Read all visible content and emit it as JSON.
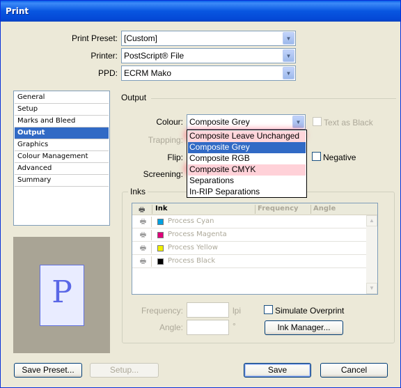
{
  "window": {
    "title": "Print"
  },
  "top": {
    "print_preset_label": "Print Preset:",
    "print_preset_value": "[Custom]",
    "printer_label": "Printer:",
    "printer_value": "PostScript® File",
    "ppd_label": "PPD:",
    "ppd_value": "ECRM Mako"
  },
  "sidebar": {
    "items": [
      {
        "label": "General"
      },
      {
        "label": "Setup"
      },
      {
        "label": "Marks and Bleed"
      },
      {
        "label": "Output"
      },
      {
        "label": "Graphics"
      },
      {
        "label": "Colour Management"
      },
      {
        "label": "Advanced"
      },
      {
        "label": "Summary"
      }
    ],
    "selected": "Output"
  },
  "preview": {
    "glyph": "P"
  },
  "output": {
    "section_title": "Output",
    "colour_label": "Colour:",
    "colour_value": "Composite Grey",
    "text_as_black_label": "Text as Black",
    "trapping_label": "Trapping:",
    "flip_label": "Flip:",
    "negative_label": "Negative",
    "screening_label": "Screening:",
    "colour_options": [
      "Composite Leave Unchanged",
      "Composite Grey",
      "Composite RGB",
      "Composite CMYK",
      "Separations",
      "In-RIP Separations"
    ],
    "highlighted_options": [
      "Composite Leave Unchanged",
      "Composite CMYK"
    ]
  },
  "inks": {
    "group_title": "Inks",
    "columns": {
      "ink": "Ink",
      "frequency": "Frequency",
      "angle": "Angle"
    },
    "rows": [
      {
        "name": "Process Cyan",
        "color": "#00a0e0"
      },
      {
        "name": "Process Magenta",
        "color": "#e0007a"
      },
      {
        "name": "Process Yellow",
        "color": "#f0f000"
      },
      {
        "name": "Process Black",
        "color": "#000000"
      }
    ],
    "frequency_label": "Frequency:",
    "frequency_unit": "lpi",
    "angle_label": "Angle:",
    "angle_unit": "°",
    "simulate_overprint_label": "Simulate Overprint",
    "ink_manager_label": "Ink Manager..."
  },
  "footer": {
    "save_preset_label": "Save Preset...",
    "setup_label": "Setup...",
    "save_label": "Save",
    "cancel_label": "Cancel"
  }
}
